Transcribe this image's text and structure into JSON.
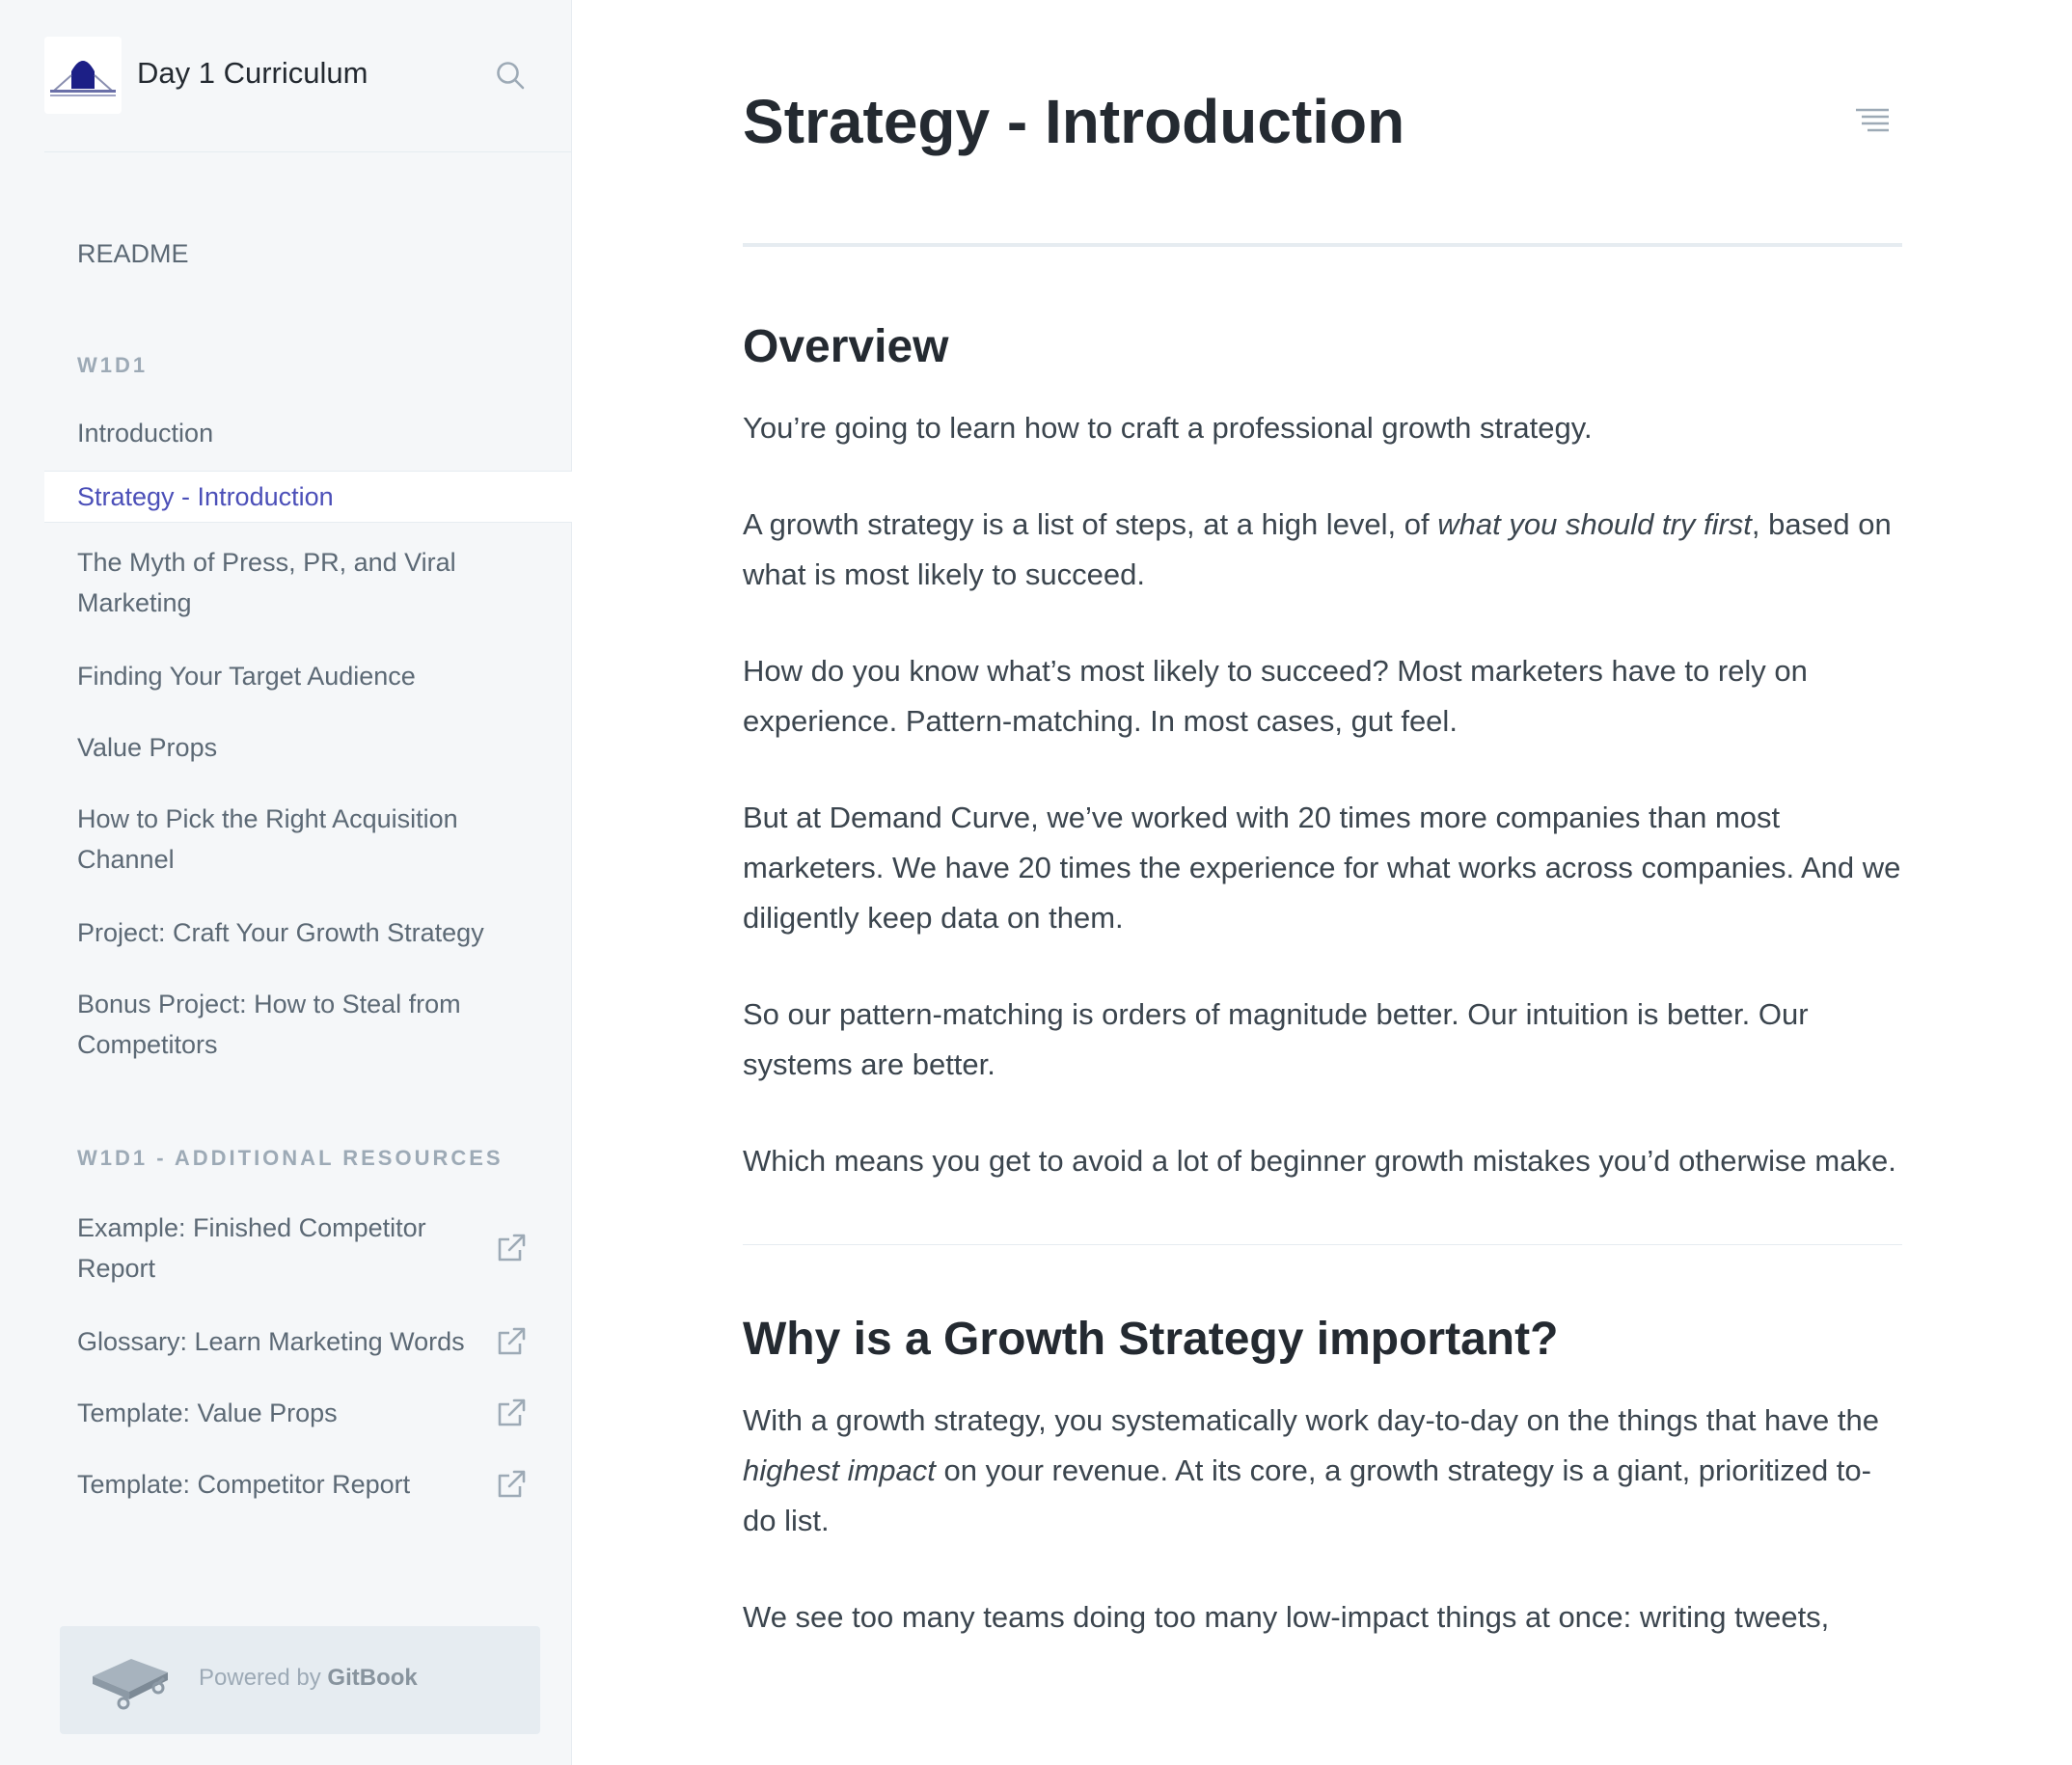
{
  "sidebar": {
    "title": "Day 1 Curriculum",
    "readme": "README",
    "section1": "W1D1",
    "items": [
      {
        "label": "Introduction"
      },
      {
        "label": "Strategy - Introduction"
      },
      {
        "label": "The Myth of Press, PR, and Viral Marketing"
      },
      {
        "label": "Finding Your Target Audience"
      },
      {
        "label": "Value Props"
      },
      {
        "label": "How to Pick the Right Acquisition Channel"
      },
      {
        "label": "Project: Craft Your Growth Strategy"
      },
      {
        "label": "Bonus Project: How to Steal from Competitors"
      }
    ],
    "section2": "W1D1 - ADDITIONAL RESOURCES",
    "resources": [
      {
        "label": "Example: Finished Competitor Report"
      },
      {
        "label": "Glossary: Learn Marketing Words"
      },
      {
        "label": "Template: Value Props"
      },
      {
        "label": "Template: Competitor Report"
      }
    ],
    "powered_prefix": "Powered by",
    "powered_brand": "GitBook"
  },
  "page": {
    "title": "Strategy - Introduction",
    "overview_heading": "Overview",
    "p1": "You’re going to learn how to craft a professional growth strategy.",
    "p2_a": "A growth strategy is a list of steps, at a high level, of ",
    "p2_em": "what you should try first",
    "p2_b": ", based on what is most likely to succeed.",
    "p3": "How do you know what’s most likely to succeed? Most marketers have to rely on experience. Pattern-matching. In most cases, gut feel.",
    "p4": "But at Demand Curve, we’ve worked with 20 times more companies than most marketers. We have 20 times the experience for what works across companies. And we diligently keep data on them.",
    "p5": "So our pattern-matching is orders of magnitude better. Our intuition is better. Our systems are better.",
    "p6": "Which means you get to avoid a lot of beginner growth mistakes you’d otherwise make.",
    "why_heading": "Why is a Growth Strategy important?",
    "p7_a": "With a growth strategy, you systematically work day-to-day on the things that have the ",
    "p7_em": "highest impact",
    "p7_b": " on your revenue. At its core, a growth strategy is a giant, prioritized to-do list.",
    "p8": "We see too many teams doing too many low-impact things at once: writing tweets,"
  },
  "colors": {
    "accent": "#4b4fb8",
    "sidebar_bg": "#f5f7f9",
    "text": "#3b454e",
    "heading": "#242a31",
    "muted": "#9daab6"
  },
  "icons": {
    "search": "search-icon",
    "toc": "table-of-contents-icon",
    "external": "external-link-icon",
    "gitbook": "gitbook-logo"
  }
}
